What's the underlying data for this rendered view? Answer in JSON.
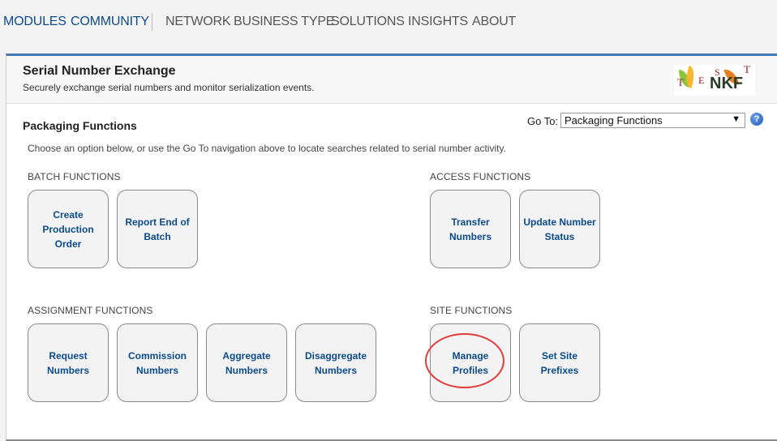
{
  "topnav": {
    "items": [
      {
        "label": "MODULES",
        "kind": "primary"
      },
      {
        "label": "COMMUNITY",
        "kind": "primary"
      },
      {
        "label": "NETWORK",
        "kind": "secondary"
      },
      {
        "label": "BUSINESS TYPE",
        "kind": "secondary"
      },
      {
        "label": "SOLUTIONS",
        "kind": "secondary"
      },
      {
        "label": "INSIGHTS",
        "kind": "secondary"
      },
      {
        "label": "ABOUT",
        "kind": "secondary"
      }
    ]
  },
  "header": {
    "title": "Serial Number Exchange",
    "subtitle": "Securely exchange serial numbers and monitor serialization events.",
    "logo_text": [
      "T",
      "E",
      "S",
      "T",
      "NKF"
    ]
  },
  "main": {
    "section_title": "Packaging Functions",
    "goto_label": "Go To:",
    "goto_value": "Packaging Functions",
    "help_icon": "?",
    "intro": "Choose an option below, or use the Go To navigation above to locate searches related to serial number activity.",
    "groups": {
      "batch": {
        "label": "BATCH FUNCTIONS",
        "tiles": [
          "Create Production Order",
          "Report End of Batch"
        ]
      },
      "access": {
        "label": "ACCESS FUNCTIONS",
        "tiles": [
          "Transfer Numbers",
          "Update Number Status"
        ]
      },
      "assignment": {
        "label": "ASSIGNMENT FUNCTIONS",
        "tiles": [
          "Request Numbers",
          "Commission Numbers",
          "Aggregate Numbers",
          "Disaggregate Numbers"
        ]
      },
      "site": {
        "label": "SITE FUNCTIONS",
        "tiles": [
          "Manage Profiles",
          "Set Site Prefixes"
        ]
      }
    }
  },
  "colors": {
    "nav_primary": "#0b4a8b",
    "tile_text": "#0b4a8b",
    "highlight": "#e23b3b",
    "panel_top_border": "#4a78ad"
  }
}
